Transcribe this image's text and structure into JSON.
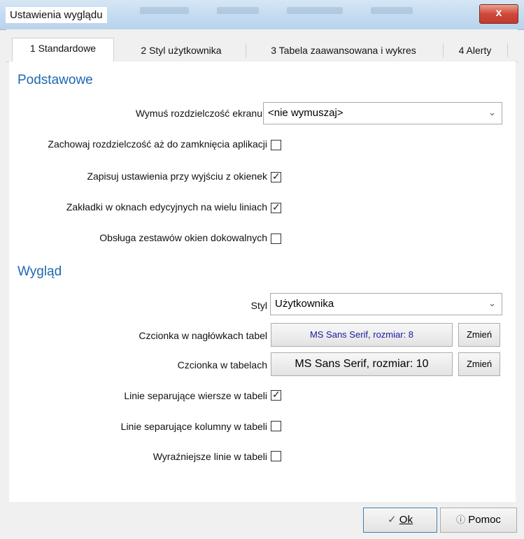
{
  "window": {
    "title": "Ustawienia wyglądu",
    "close_label": "x"
  },
  "tabs": [
    {
      "label": "1 Standardowe",
      "active": true
    },
    {
      "label": "2 Styl użytkownika",
      "active": false
    },
    {
      "label": "3 Tabela zaawansowana i wykres",
      "active": false
    },
    {
      "label": "4 Alerty",
      "active": false
    }
  ],
  "podstawowe": {
    "heading": "Podstawowe",
    "resolution_label": "Wymuś rozdzielczość ekranu",
    "resolution_value": "<nie wymuszaj>",
    "keep_resolution_label": "Zachowaj rozdzielczość aż do zamknięcia aplikacji",
    "keep_resolution_checked": false,
    "save_settings_label": "Zapisuj ustawienia przy wyjściu z okienek",
    "save_settings_checked": true,
    "multiline_tabs_label": "Zakładki w oknach edycyjnych na wielu liniach",
    "multiline_tabs_checked": true,
    "dock_sets_label": "Obsługa zestawów okien dokowalnych",
    "dock_sets_checked": false
  },
  "wyglad": {
    "heading": "Wygląd",
    "style_label": "Styl",
    "style_value": "Użytkownika",
    "header_font_label": "Czcionka w nagłówkach tabel",
    "header_font_value": "MS Sans Serif, rozmiar: 8",
    "header_font_button": "Zmień",
    "table_font_label": "Czcionka w  tabelach",
    "table_font_value": "MS Sans Serif, rozmiar: 10",
    "table_font_button": "Zmień",
    "row_lines_label": "Linie separujące wiersze w tabeli",
    "row_lines_checked": true,
    "col_lines_label": "Linie separujące kolumny w tabeli",
    "col_lines_checked": false,
    "bold_lines_label": "Wyraźniejsze linie w tabeli",
    "bold_lines_checked": false
  },
  "footer": {
    "ok_label": "Ok",
    "help_label": "Pomoc"
  },
  "colors": {
    "section_heading": "#1f67b1",
    "header_font_text": "#1a1aa0"
  }
}
